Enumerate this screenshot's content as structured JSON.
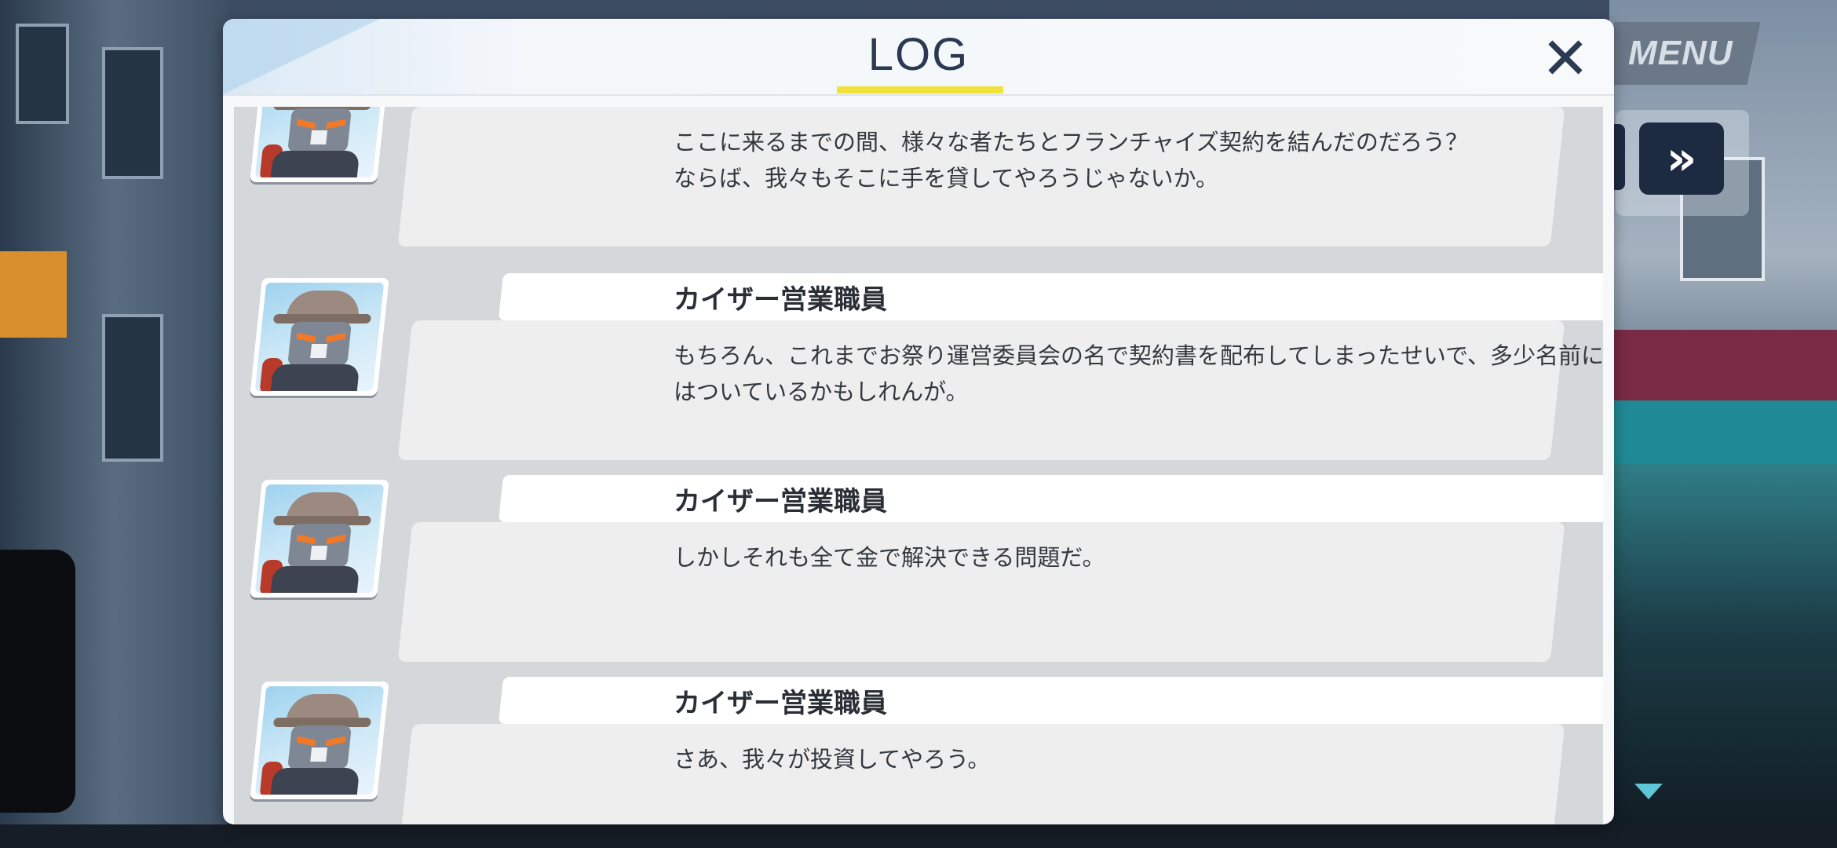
{
  "hud": {
    "menu_label": "MENU",
    "fast_forward_glyph": "»"
  },
  "log": {
    "title": "LOG",
    "close_glyph": "✕",
    "entries": [
      {
        "speaker": "",
        "message": "ここに来るまでの間、様々な者たちとフランチャイズ契約を結んだのだろう？\nならば、我々もそこに手を貸してやろうじゃないか。"
      },
      {
        "speaker": "カイザー営業職員",
        "message": "もちろん、これまでお祭り運営委員会の名で契約書を配布してしまったせいで、多少名前に傷\nはついているかもしれんが。"
      },
      {
        "speaker": "カイザー営業職員",
        "message": "しかしそれも全て金で解決できる問題だ。"
      },
      {
        "speaker": "カイザー営業職員",
        "message": "さあ、我々が投資してやろう。"
      }
    ]
  },
  "colors": {
    "accent_underline": "#f1e13b",
    "title_text": "#2b3a52",
    "button_navy": "#1c2b42"
  },
  "icons": {
    "close": "close-icon",
    "fast_forward": "fast-forward-icon",
    "scroll_down": "chevron-down-icon",
    "avatar": "kaiser-robot-avatar"
  }
}
